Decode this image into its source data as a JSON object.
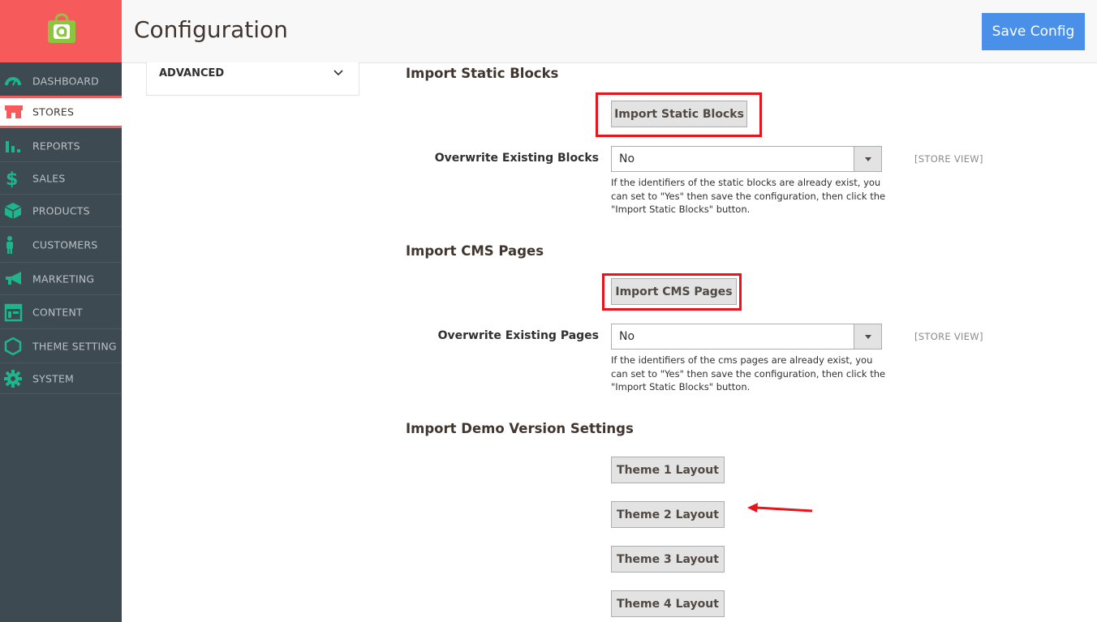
{
  "header": {
    "title": "Configuration",
    "save_label": "Save Config"
  },
  "sidebar": {
    "items": [
      {
        "label": "DASHBOARD",
        "icon": "dashboard-icon"
      },
      {
        "label": "STORES",
        "icon": "store-icon"
      },
      {
        "label": "REPORTS",
        "icon": "reports-icon"
      },
      {
        "label": "SALES",
        "icon": "dollar-icon"
      },
      {
        "label": "PRODUCTS",
        "icon": "box-icon"
      },
      {
        "label": "CUSTOMERS",
        "icon": "person-icon"
      },
      {
        "label": "MARKETING",
        "icon": "megaphone-icon"
      },
      {
        "label": "CONTENT",
        "icon": "layout-icon"
      },
      {
        "label": "THEME SETTING",
        "icon": "hexagon-icon"
      },
      {
        "label": "SYSTEM",
        "icon": "gear-icon"
      }
    ]
  },
  "section": {
    "title": "ADVANCED"
  },
  "static_blocks": {
    "title": "Import Static Blocks",
    "button_label": "Import Static Blocks",
    "overwrite_label": "Overwrite Existing Blocks",
    "overwrite_value": "No",
    "note": "If the identifiers of the static blocks are already exist, you can set to \"Yes\" then save the configuration, then click the \"Import Static Blocks\" button.",
    "scope": "[STORE VIEW]"
  },
  "cms_pages": {
    "title": "Import CMS Pages",
    "button_label": "Import CMS Pages",
    "overwrite_label": "Overwrite Existing Pages",
    "overwrite_value": "No",
    "note": "If the identifiers of the cms pages are already exist, you can set to \"Yes\" then save the configuration, then click the \"Import Static Blocks\" button.",
    "scope": "[STORE VIEW]"
  },
  "demo": {
    "title": "Import Demo Version Settings",
    "buttons": [
      "Theme 1 Layout",
      "Theme 2 Layout",
      "Theme 3 Layout",
      "Theme 4 Layout"
    ]
  },
  "colors": {
    "sidebar_bg": "#3e4a52",
    "brand_red": "#f65a5a",
    "icon_green": "#1fb58a",
    "save_blue": "#4a90e8",
    "highlight_red": "#e8141b"
  }
}
